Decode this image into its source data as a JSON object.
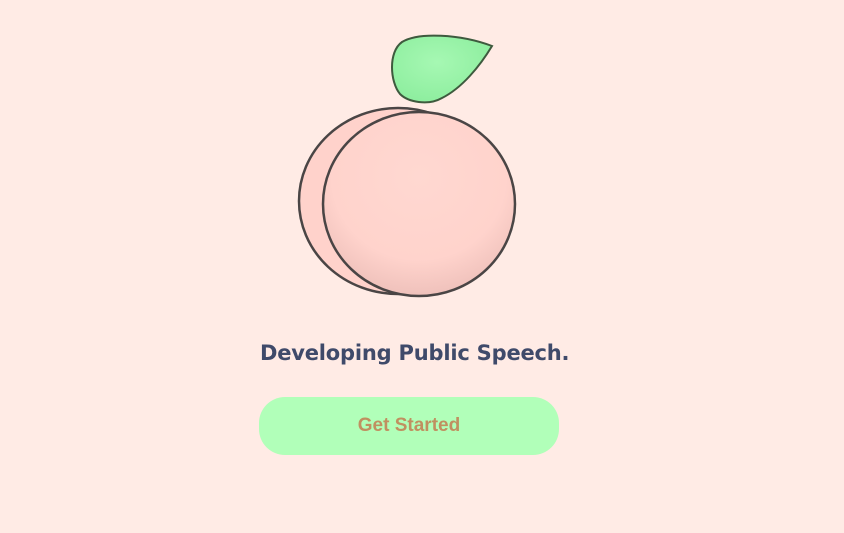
{
  "colors": {
    "background": "#ffebe5",
    "peach_fill": "#ffd4cd",
    "peach_stroke": "#4a4545",
    "leaf_fill": "#98f5a8",
    "leaf_stroke": "#3e5a3e",
    "button_bg": "#b1ffb9",
    "button_text": "#c09060",
    "tagline_text": "#3f4a6a"
  },
  "logo": {
    "icon": "peach-icon"
  },
  "hero": {
    "tagline": "Developing Public Speech."
  },
  "cta": {
    "label": "Get Started"
  }
}
